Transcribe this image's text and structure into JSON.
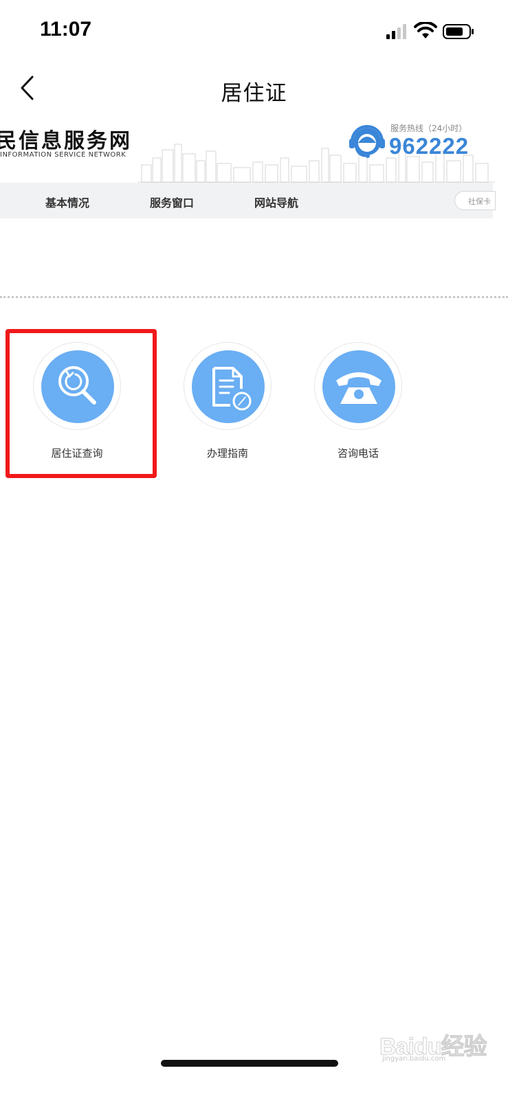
{
  "status_bar": {
    "time": "11:07",
    "signal_icon": "signal-bars-icon",
    "wifi_icon": "wifi-icon",
    "battery_icon": "battery-icon"
  },
  "nav": {
    "title": "居住证",
    "back_icon": "chevron-left-icon"
  },
  "site_header": {
    "name": "民信息服务网",
    "name_en": "INFORMATION SERVICE NETWORK",
    "hotline_label": "服务热线（24小时）",
    "hotline_number": "962222",
    "hotline_icon": "headset-agent-icon",
    "accent_color": "#3a86d8"
  },
  "menu": {
    "items": [
      {
        "label": "基本情况"
      },
      {
        "label": "服务窗口"
      },
      {
        "label": "网站导航"
      }
    ],
    "search_placeholder": "社保卡"
  },
  "services": [
    {
      "label": "居住证查询",
      "icon": "search-refresh-icon",
      "highlighted": true
    },
    {
      "label": "办理指南",
      "icon": "document-compass-icon",
      "highlighted": false
    },
    {
      "label": "咨询电话",
      "icon": "telephone-icon",
      "highlighted": false
    }
  ],
  "colors": {
    "service_circle": "#6aaef3",
    "highlight": "#f0181a"
  },
  "watermark": {
    "logo": "Baidu经验",
    "url": "jingyan.baidu.com"
  }
}
